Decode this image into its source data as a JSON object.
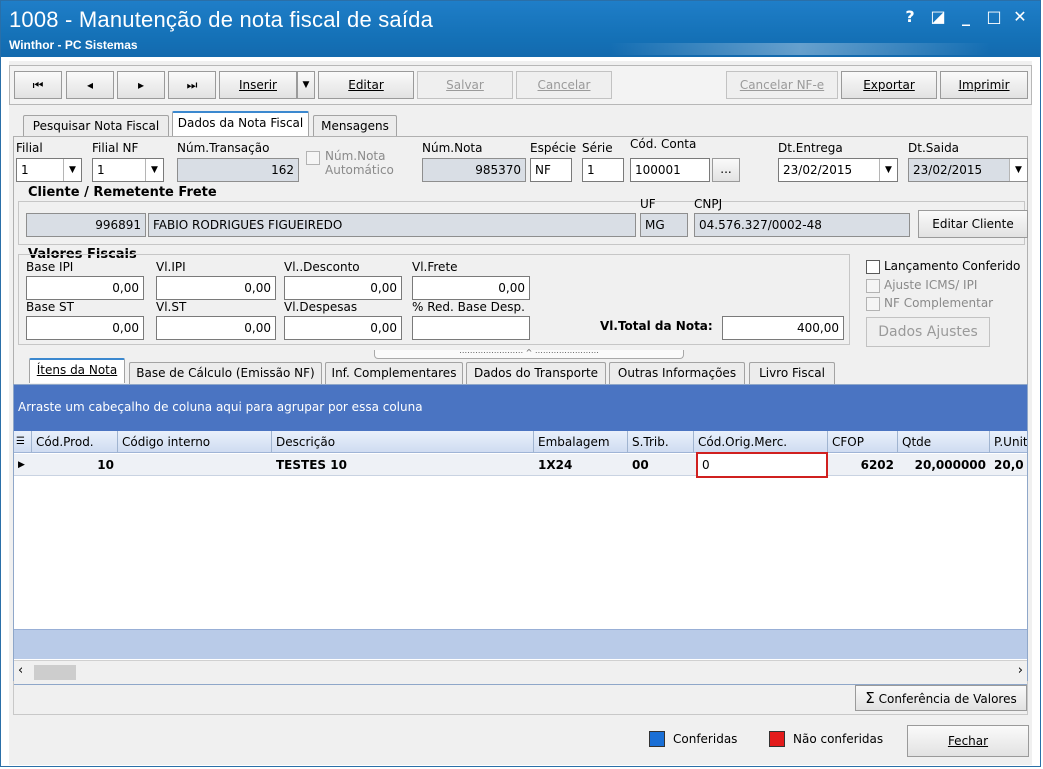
{
  "window": {
    "title": "1008 - Manutenção de nota fiscal de saída",
    "subtitle": "Winthor - PC Sistemas",
    "controls": {
      "help": "?",
      "restore": "◪",
      "minimize": "_",
      "maximize": "□",
      "close": "✕"
    }
  },
  "toolbar": {
    "first": "⏮",
    "prev": "◂",
    "next": "▸",
    "last": "⏭",
    "insert": "Inserir",
    "edit": "Editar",
    "save": "Salvar",
    "cancel": "Cancelar",
    "cancel_nfe": "Cancelar NF-e",
    "export": "Exportar",
    "print": "Imprimir"
  },
  "tabs": {
    "search": "Pesquisar Nota Fiscal",
    "data": "Dados da Nota Fiscal",
    "messages": "Mensagens"
  },
  "header": {
    "filial_label": "Filial",
    "filial_value": "1",
    "filial_nf_label": "Filial NF",
    "filial_nf_value": "1",
    "num_transacao_label": "Núm.Transação",
    "num_transacao_value": "162",
    "num_auto_label_1": "Núm.Nota",
    "num_auto_label_2": "Automático",
    "num_nota_label": "Núm.Nota",
    "num_nota_value": "985370",
    "especie_label": "Espécie",
    "especie_value": "NF",
    "serie_label": "Série",
    "serie_value": "1",
    "cod_conta_label": "Cód. Conta",
    "cod_conta_value": "100001",
    "cod_conta_button": "...",
    "dt_entrega_label": "Dt.Entrega",
    "dt_entrega_value": "23/02/2015",
    "dt_saida_label": "Dt.Saida",
    "dt_saida_value": "23/02/2015"
  },
  "client": {
    "group_title": "Cliente / Remetente Frete",
    "code": "996891",
    "name": "FABIO RODRIGUES FIGUEIREDO",
    "uf_label": "UF",
    "uf_value": "MG",
    "cnpj_label": "CNPJ",
    "cnpj_value": "04.576.327/0002-48",
    "edit_button": "Editar Cliente"
  },
  "fiscal": {
    "group_title": "Valores Fiscais",
    "base_ipi_label": "Base IPI",
    "base_ipi_value": "0,00",
    "vl_ipi_label": "Vl.IPI",
    "vl_ipi_value": "0,00",
    "vl_desconto_label": "Vl..Desconto",
    "vl_desconto_value": "0,00",
    "vl_frete_label": "Vl.Frete",
    "vl_frete_value": "0,00",
    "base_st_label": "Base ST",
    "base_st_value": "0,00",
    "vl_st_label": "Vl.ST",
    "vl_st_value": "0,00",
    "vl_despesas_label": "Vl.Despesas",
    "vl_despesas_value": "0,00",
    "red_base_label": "% Red. Base Desp.",
    "red_base_value": "",
    "total_label": "Vl.Total da Nota:",
    "total_value": "400,00"
  },
  "options": {
    "lancamento": "Lançamento Conferido",
    "ajuste": "Ajuste ICMS/ IPI",
    "nf_comp": "NF Complementar",
    "dados_ajustes": "Dados Ajustes"
  },
  "sub_tabs": {
    "itens": "Ítens da Nota",
    "base_calc": "Base de Cálculo (Emissão NF)",
    "inf_comp": "Inf. Complementares",
    "transporte": "Dados do Transporte",
    "outras": "Outras Informações",
    "livro": "Livro Fiscal"
  },
  "grid": {
    "group_hint": "Arraste um cabeçalho de coluna aqui para agrupar por essa coluna",
    "columns": [
      "Cód.Prod.",
      "Código interno",
      "Descrição",
      "Embalagem",
      "S.Trib.",
      "Cód.Orig.Merc.",
      "CFOP",
      "Qtde",
      "P.Unitá"
    ],
    "row": [
      "10",
      "",
      "TESTES 10",
      "1X24",
      "00",
      "0",
      "6202",
      "20,000000",
      "20,0"
    ]
  },
  "footer": {
    "conferencia": "Conferência de Valores",
    "legend_conferidas": "Conferidas",
    "legend_nao": "Não conferidas",
    "close": "Fechar"
  },
  "colors": {
    "title_bar": "#1a77c0",
    "grid_band": "#4472c4",
    "conferidas": "#1a6fd6",
    "nao_conferidas": "#e31b1b",
    "highlight": "#d0201f"
  }
}
